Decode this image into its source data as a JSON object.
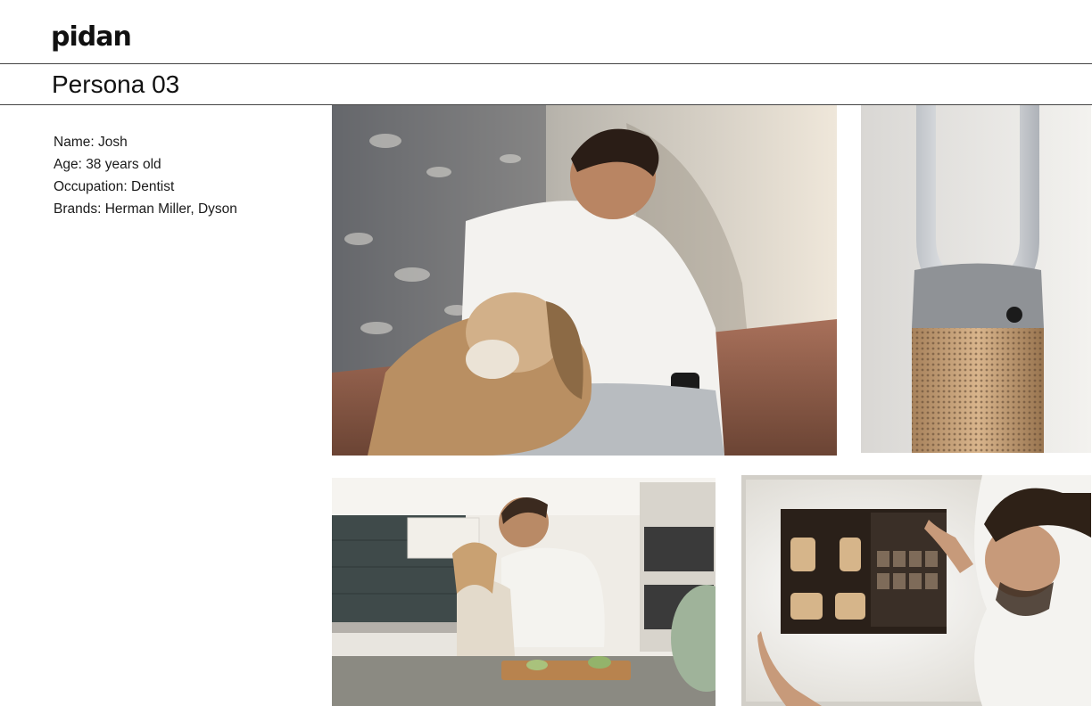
{
  "brand": {
    "logo_text": "pidan"
  },
  "page": {
    "title": "Persona 03"
  },
  "persona": {
    "name": "Name: Josh",
    "age": "Age: 38 years old",
    "occupation": "Occupation: Dentist",
    "brands": "Brands: Herman Miller, Dyson"
  },
  "images": [
    {
      "name": "man-with-dog-photo",
      "subject": "Man in white t-shirt sitting with basset hound"
    },
    {
      "name": "dyson-purifier-photo",
      "subject": "Dyson air purifier tower, silver and gold"
    },
    {
      "name": "father-daughter-kitchen-photo",
      "subject": "Father and daughter cutting vegetables in kitchen"
    },
    {
      "name": "dentist-xray-photo",
      "subject": "Dentist examining dental x-rays on light box"
    }
  ],
  "colors": {
    "text": "#111111",
    "rule": "#444444",
    "background": "#ffffff"
  }
}
